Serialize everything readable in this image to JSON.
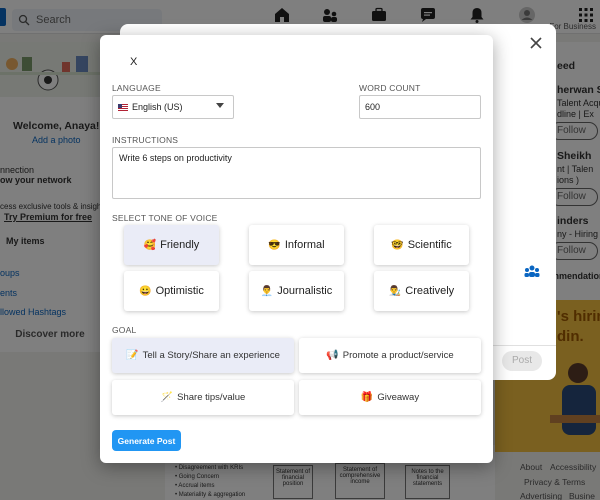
{
  "background": {
    "search_placeholder": "Search",
    "for_business": "For Business",
    "left": {
      "welcome": "Welcome, Anaya!",
      "add_photo": "Add a photo",
      "connections_1": "nnection",
      "connections_2": "ow your network",
      "premium_1": "cess exclusive tools & insights",
      "premium_2": "Try Premium for free",
      "my_items": "My items",
      "groups": "oups",
      "events": "ents",
      "hashtags": "llowed Hashtags",
      "discover_more": "Discover more"
    },
    "right": {
      "heading": "eed",
      "person1_name": "herwan So",
      "person1_sub1": "Talent Acqu",
      "person1_sub2": "dline | Ex",
      "person2_name": "Sheikh",
      "person2_sub1": "nt | Talen",
      "person2_sub2": "ions )",
      "person3_name": "inders",
      "person3_sub1": "ny - Hiring",
      "follow": "Follow",
      "recommendations": "mmendation",
      "ad_line1": "'s hirin",
      "ad_line2": "din."
    },
    "footer": {
      "about": "About",
      "accessibility": "Accessibility",
      "privacy": "Privacy & Terms",
      "advertising": "Advertising",
      "business": "Busine"
    },
    "doc_preview": {
      "bullet1": "• Disagreement with KRIs",
      "bullet2": "• Going Concern",
      "bullet3": "• Accrual items",
      "bullet4": "• Materiality & aggregation",
      "box1": "Statement of financial position",
      "box2": "Statement of comprehensive income",
      "box3": "Notes to the financial statements"
    },
    "under_dialog": {
      "post_label": "Post"
    }
  },
  "modal": {
    "close_label": "X",
    "language": {
      "label": "LANGUAGE",
      "value": "English (US)"
    },
    "word_count": {
      "label": "WORD COUNT",
      "value": "600"
    },
    "instructions": {
      "label": "INSTRUCTIONS",
      "value": "Write 6 steps on productivity"
    },
    "tone": {
      "label": "SELECT TONE OF VOICE",
      "options": [
        {
          "emoji": "🥰",
          "label": "Friendly",
          "selected": true
        },
        {
          "emoji": "😎",
          "label": "Informal",
          "selected": false
        },
        {
          "emoji": "🤓",
          "label": "Scientific",
          "selected": false
        },
        {
          "emoji": "😀",
          "label": "Optimistic",
          "selected": false
        },
        {
          "emoji": "👨‍💼",
          "label": "Journalistic",
          "selected": false
        },
        {
          "emoji": "👨‍🎨",
          "label": "Creatively",
          "selected": false
        }
      ]
    },
    "goal": {
      "label": "GOAL",
      "options": [
        {
          "emoji": "📝",
          "label": "Tell a Story/Share an experience",
          "selected": true
        },
        {
          "emoji": "📢",
          "label": "Promote a product/service",
          "selected": false
        },
        {
          "emoji": "🪄",
          "label": "Share tips/value",
          "selected": false
        },
        {
          "emoji": "🎁",
          "label": "Giveaway",
          "selected": false
        }
      ]
    },
    "generate_label": "Generate Post"
  },
  "icons": {
    "home": "home-icon",
    "network": "my-network-icon",
    "jobs": "jobs-icon",
    "messaging": "messaging-icon",
    "notifications": "notifications-icon",
    "me": "avatar",
    "work": "grid-icon"
  },
  "colors": {
    "primary_button": "#2196f3",
    "selected_option": "#eaecf7",
    "linkedin_blue": "#0a66c2"
  }
}
